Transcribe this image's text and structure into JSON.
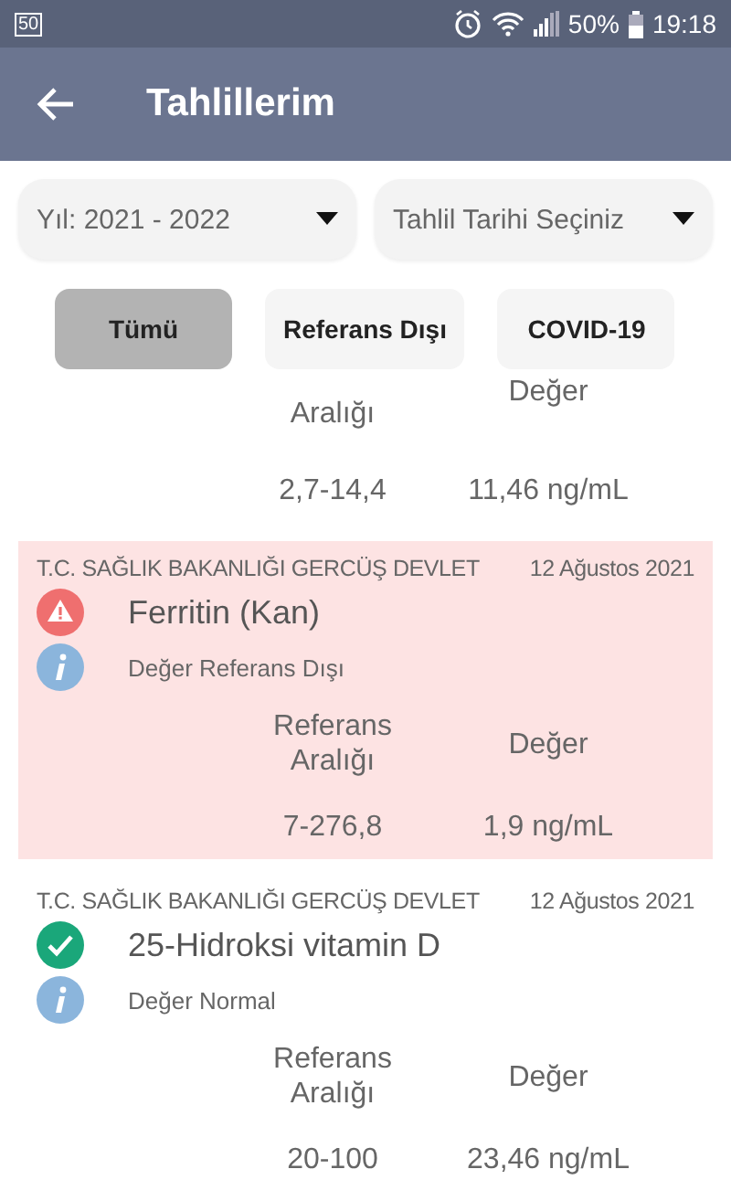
{
  "status_bar": {
    "badge": "50",
    "battery": "50%",
    "time": "19:18"
  },
  "app_bar": {
    "title": "Tahlillerim"
  },
  "filters": [
    {
      "value": "Yıl: 2021 - 2022"
    },
    {
      "value": "Tahlil Tarihi Seçiniz"
    }
  ],
  "chips": [
    {
      "label": "Tümü",
      "selected": true
    },
    {
      "label": "Referans Dışı",
      "selected": false
    },
    {
      "label": "COVID-19",
      "selected": false
    }
  ],
  "results": [
    {
      "kind": "partial",
      "range_label": "Aralığı",
      "value_label": "Değer",
      "range": "2,7-14,4",
      "value": "11,46 ng/mL"
    },
    {
      "kind": "card",
      "institution": "T.C. SAĞLIK BAKANLIĞI GERCÜŞ DEVLET",
      "date": "12 Ağustos 2021",
      "test": "Ferritin (Kan)",
      "out_of_range": true,
      "status_text": "Değer Referans Dışı",
      "range_label": "Referans Aralığı",
      "value_label": "Değer",
      "range": "7-276,8",
      "value": "1,9 ng/mL"
    },
    {
      "kind": "card",
      "institution": "T.C. SAĞLIK BAKANLIĞI GERCÜŞ DEVLET",
      "date": "12 Ağustos 2021",
      "test": "25-Hidroksi vitamin D",
      "out_of_range": false,
      "status_text": "Değer Normal",
      "range_label": "Referans Aralığı",
      "value_label": "Değer",
      "range": "20-100",
      "value": "23,46 ng/mL"
    }
  ]
}
